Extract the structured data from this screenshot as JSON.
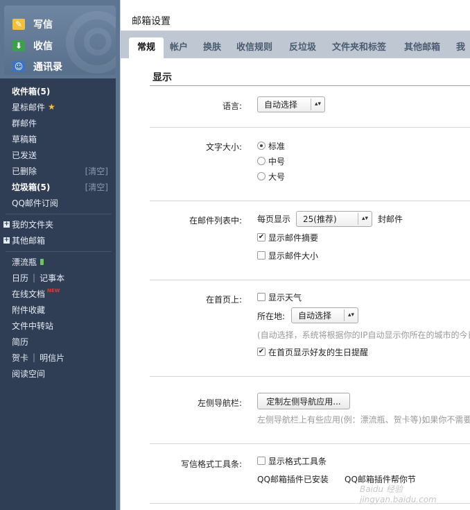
{
  "sidebar": {
    "actions": {
      "write": "写信",
      "receive": "收信",
      "contacts": "通讯录"
    },
    "folders": {
      "inbox": "收件箱(5)",
      "starred": "星标邮件",
      "group": "群邮件",
      "drafts": "草稿箱",
      "sent": "已发送",
      "deleted": "已删除",
      "deleted_clear": "[清空]",
      "junk": "垃圾箱(5)",
      "junk_clear": "[清空]",
      "subscription": "QQ邮件订阅",
      "my_folders": "我的文件夹",
      "other_mailboxes": "其他邮箱",
      "drift_bottle": "漂流瓶",
      "calendar": "日历",
      "notebook": "记事本",
      "online_docs": "在线文档",
      "new_badge": "NEW",
      "attachments": "附件收藏",
      "file_transfer": "文件中转站",
      "resume": "简历",
      "greeting_card": "贺卡",
      "postcard": "明信片",
      "reading_space": "阅读空间"
    }
  },
  "panel": {
    "title": "邮箱设置",
    "tabs": [
      "常规",
      "帐户",
      "换肤",
      "收信规则",
      "反垃圾",
      "文件夹和标签",
      "其他邮箱",
      "我的"
    ],
    "section_title": "显示",
    "language": {
      "label": "语言:",
      "value": "自动选择"
    },
    "font_size": {
      "label": "文字大小:",
      "options": [
        "标准",
        "中号",
        "大号"
      ],
      "selected": "标准"
    },
    "mail_list": {
      "label": "在邮件列表中:",
      "per_page_prefix": "每页显示",
      "per_page_value": "25(推荐)",
      "per_page_suffix": "封邮件",
      "show_summary": "显示邮件摘要",
      "show_size": "显示邮件大小"
    },
    "homepage": {
      "label": "在首页上:",
      "show_weather": "显示天气",
      "location_label": "所在地:",
      "location_value": "自动选择",
      "location_hint": "(自动选择，系统将根据你的IP自动显示你所在的城市的今日",
      "birthday": "在首页显示好友的生日提醒"
    },
    "left_nav": {
      "label": "左侧导航栏:",
      "button": "定制左侧导航应用...",
      "hint": "左侧导航栏上有些应用(例：漂流瓶、贺卡等)如果你不需要"
    },
    "toolbar": {
      "label": "写信格式工具条:",
      "show_toolbar": "显示格式工具条",
      "plugin_installed": "QQ邮箱插件已安装",
      "plugin_partial": "QQ邮箱插件帮你节"
    },
    "watermark": "Baidu 经验 jingyan.baidu.com"
  }
}
